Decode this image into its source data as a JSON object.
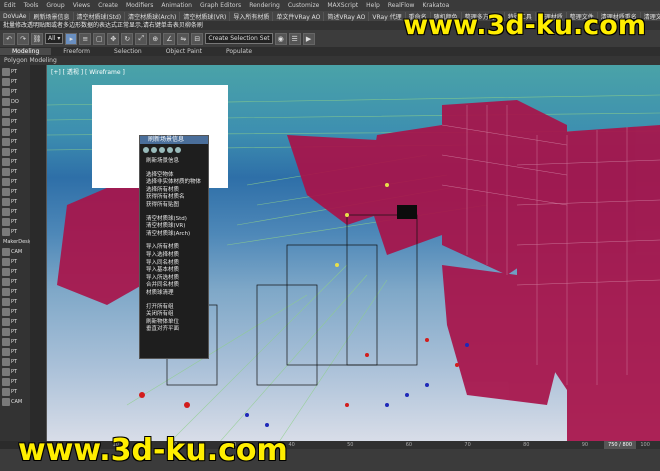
{
  "menu": [
    "Edit",
    "Tools",
    "Group",
    "Views",
    "Create",
    "Modifiers",
    "Animation",
    "Graph Editors",
    "Rendering",
    "Customize",
    "MAXScript",
    "Help",
    "RealFlow",
    "Krakatoa"
  ],
  "scripts": [
    "DoVuAe",
    "刷新场景信息",
    "清空材质球(Std)",
    "清空材质球(Arch)",
    "清空材质球(VR)",
    "导入所有材质",
    "单文件VRay AO",
    "简述VRay AO",
    "VRay 代理",
    "重命名",
    "随机颜色",
    "整理多方向的",
    "特殊工具",
    "整理材质",
    "整理文件",
    "清理材质重名",
    "清理文件",
    "管理道",
    "动画规划器",
    "整理文件",
    "管理器"
  ],
  "statusline": "批量修改透明贴图或者多边形数据的表达式正常显示,请右键单击表贝柳条刷",
  "selection_set": "Create Selection Set",
  "ribbon_tabs": [
    "Modeling",
    "Freeform",
    "Selection",
    "Object Paint",
    "Populate"
  ],
  "sub_ribbon": "Polygon Modeling",
  "left_tools": [
    "PT",
    "PT",
    "PT",
    "DO",
    "PT",
    "PT",
    "PT",
    "PT",
    "PT",
    "PT",
    "PT",
    "PT",
    "PT",
    "PT",
    "PT",
    "PT",
    "PT",
    "MakerDesign",
    "CAM",
    "PT",
    "PT",
    "PT",
    "PT",
    "PT",
    "PT",
    "PT",
    "PT",
    "PT",
    "PT",
    "PT",
    "PT",
    "PT",
    "PT",
    "CAM"
  ],
  "viewport_label": "[+] [ 透视 ] [ Wireframe ]",
  "dialog": {
    "title": "刷新场景信息",
    "items": [
      "刷新场景信息",
      "选择空物体",
      "选择非实体材质的物体",
      "选择所有材质",
      "获得所有材质名",
      "获得所有贴图",
      "清空材质球(Std)",
      "清空材质球(VR)",
      "清空材质球(Arch)",
      "导入所有材质",
      "导入选择材质",
      "导入同名材质",
      "导入基本材质",
      "导入所选材质",
      "合并同名材质",
      "材质球清理",
      "打开所有组",
      "关闭所有组",
      "刷新物体单位",
      "垂直对齐平面"
    ]
  },
  "timeline_ticks": [
    "0",
    "10",
    "20",
    "30",
    "40",
    "50",
    "60",
    "70",
    "80",
    "90",
    "100"
  ],
  "frame_readout": "750 / 800",
  "watermark": "www.3d-ku.com",
  "colors": {
    "accent": "#ffee00",
    "buildings": "#b0124a"
  }
}
